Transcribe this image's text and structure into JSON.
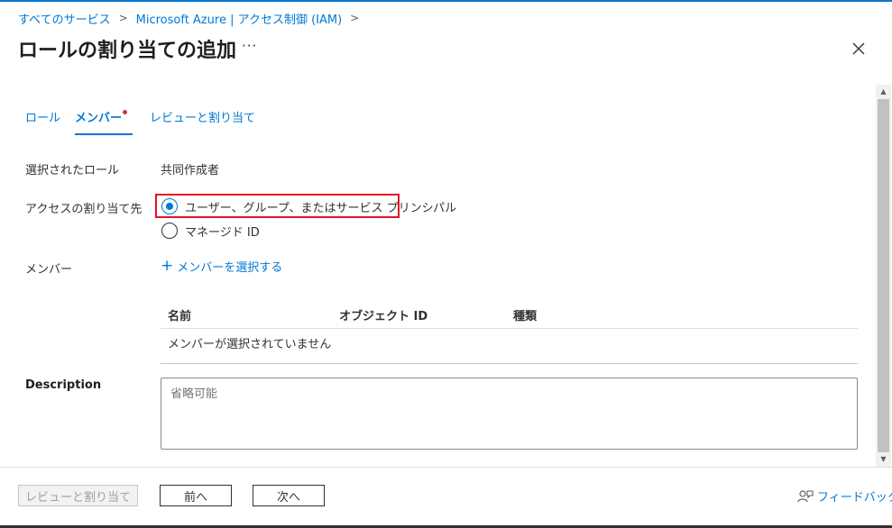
{
  "breadcrumb": {
    "items": [
      "すべてのサービス",
      "Microsoft Azure | アクセス制御 (IAM)"
    ]
  },
  "title": "ロールの割り当ての追加",
  "more_icon": "ellipsis-icon",
  "close_icon": "close-icon",
  "tabs": [
    {
      "label": "ロール",
      "active": false
    },
    {
      "label": "メンバー",
      "active": true,
      "has_dot": true
    },
    {
      "label": "レビューと割り当て",
      "active": false
    }
  ],
  "form": {
    "selected_role_label": "選択されたロール",
    "selected_role_value": "共同作成者",
    "assign_access_label": "アクセスの割り当て先",
    "radio_options": [
      {
        "label": "ユーザー、グループ、またはサービス プリンシパル",
        "checked": true
      },
      {
        "label": "マネージド ID",
        "checked": false
      }
    ],
    "members_label": "メンバー",
    "add_members_link": "メンバーを選択する",
    "table": {
      "columns": [
        "名前",
        "オブジェクト ID",
        "種類"
      ],
      "empty_text": "メンバーが選択されていません"
    },
    "description_label": "Description",
    "description_placeholder": "省略可能"
  },
  "footer": {
    "review_button": "レビューと割り当て",
    "prev_button": "前へ",
    "next_button": "次へ",
    "feedback_link": "フィードバック"
  },
  "colors": {
    "accent": "#0078d4",
    "highlight": "#e81123",
    "notification_dot": "#d13438"
  }
}
